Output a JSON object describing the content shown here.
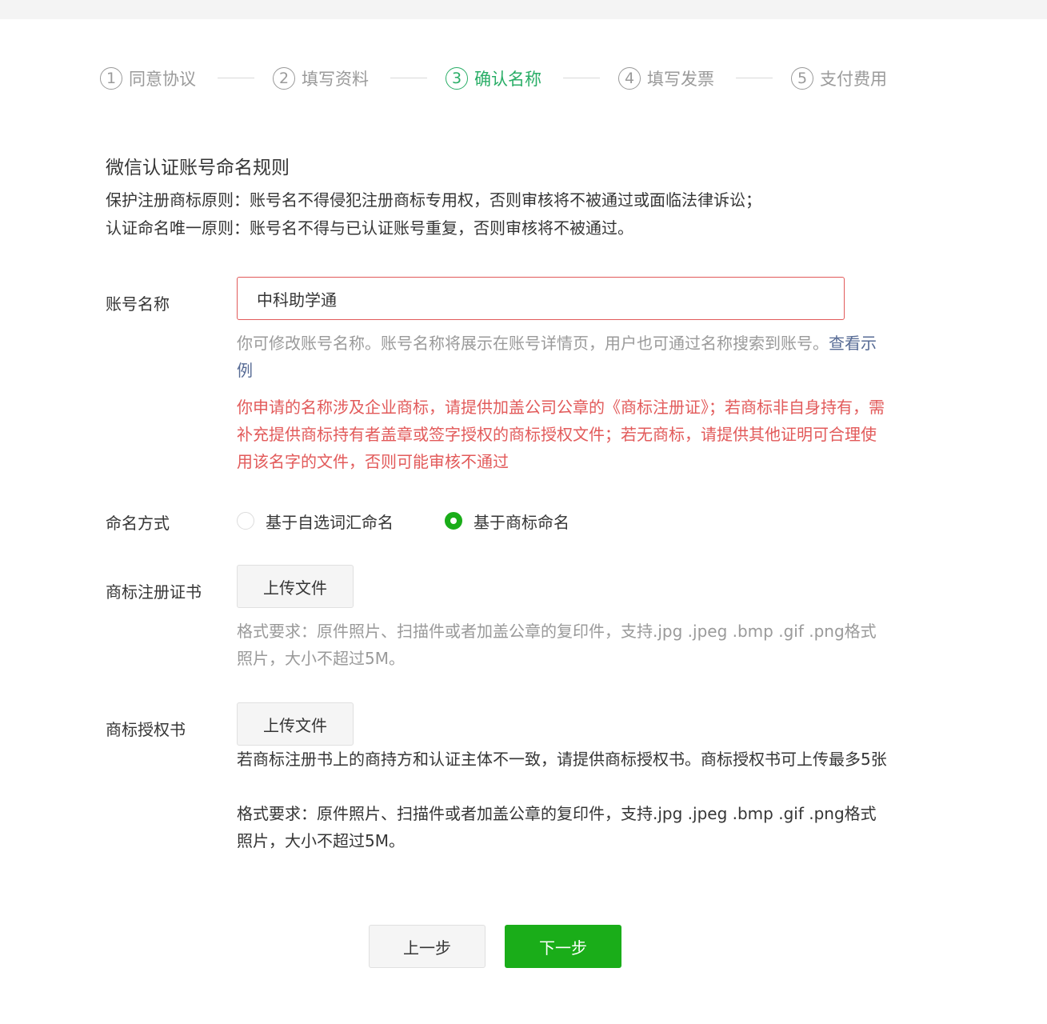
{
  "steps": [
    {
      "num": "1",
      "label": "同意协议"
    },
    {
      "num": "2",
      "label": "填写资料"
    },
    {
      "num": "3",
      "label": "确认名称"
    },
    {
      "num": "4",
      "label": "填写发票"
    },
    {
      "num": "5",
      "label": "支付费用"
    }
  ],
  "active_step": 3,
  "rules": {
    "title": "微信认证账号命名规则",
    "line1": "保护注册商标原则：账号名不得侵犯注册商标专用权，否则审核将不被通过或面临法律诉讼；",
    "line2": "认证命名唯一原则：账号名不得与已认证账号重复，否则审核将不被通过。"
  },
  "account_name": {
    "label": "账号名称",
    "value": "中科助学通",
    "hint": "你可修改账号名称。账号名称将展示在账号详情页，用户也可通过名称搜索到账号。",
    "hint_link": "查看示例",
    "warning": "你申请的名称涉及企业商标，请提供加盖公司公章的《商标注册证》；若商标非自身持有，需补充提供商标持有者盖章或签字授权的商标授权文件；若无商标，请提供其他证明可合理使用该名字的文件，否则可能审核不通过"
  },
  "naming_method": {
    "label": "命名方式",
    "options": [
      "基于自选词汇命名",
      "基于商标命名"
    ],
    "selected": "基于商标命名"
  },
  "trademark_cert": {
    "label": "商标注册证书",
    "button": "上传文件",
    "format_hint": "格式要求：原件照片、扫描件或者加盖公章的复印件，支持.jpg .jpeg .bmp .gif .png格式照片，大小不超过5M。"
  },
  "trademark_auth": {
    "label": "商标授权书",
    "button": "上传文件",
    "note": "若商标注册书上的商持方和认证主体不一致，请提供商标授权书。商标授权书可上传最多5张",
    "format_hint": "格式要求：原件照片、扫描件或者加盖公章的复印件，支持.jpg .jpeg .bmp .gif .png格式照片，大小不超过5M。"
  },
  "footer": {
    "prev": "上一步",
    "next": "下一步"
  },
  "colors": {
    "accent_green": "#1aad19",
    "step_active": "#2aae67",
    "error_red": "#e25a5a",
    "link_blue": "#576b95"
  }
}
